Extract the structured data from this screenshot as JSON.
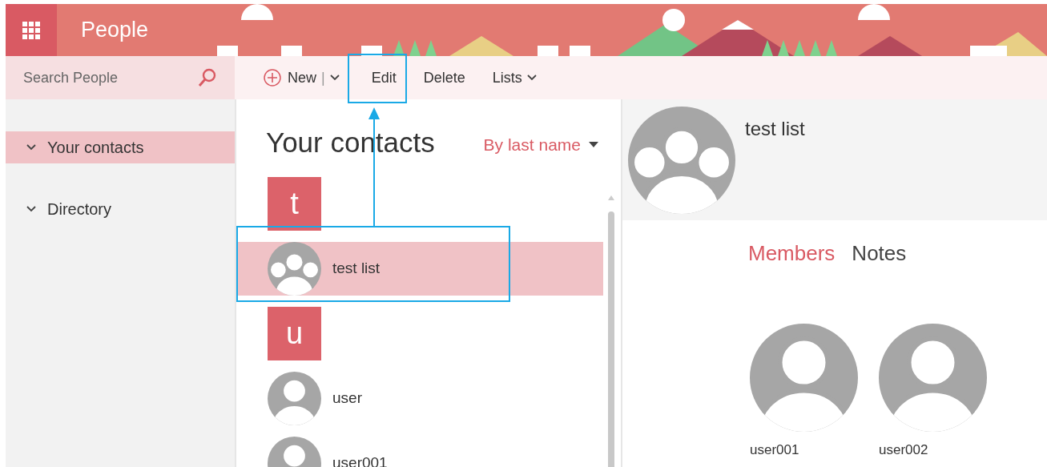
{
  "app": {
    "title": "People"
  },
  "search": {
    "placeholder": "Search People"
  },
  "toolbar": [
    {
      "kind": "new",
      "label": "New",
      "separator": "|"
    },
    {
      "kind": "plain",
      "label": "Edit"
    },
    {
      "kind": "plain",
      "label": "Delete"
    },
    {
      "kind": "menu",
      "label": "Lists"
    }
  ],
  "sidebar": {
    "items": [
      {
        "label": "Your contacts",
        "selected": true
      },
      {
        "label": "Directory",
        "selected": false
      }
    ]
  },
  "contacts": {
    "title": "Your contacts",
    "sort": "By last name",
    "items": [
      {
        "kind": "letter",
        "label": "t"
      },
      {
        "kind": "group",
        "name": "test list",
        "selected": true
      },
      {
        "kind": "letter",
        "label": "u"
      },
      {
        "kind": "person",
        "name": "user",
        "selected": false
      },
      {
        "kind": "person",
        "name": "user001",
        "selected": false
      }
    ]
  },
  "detail": {
    "name": "test list",
    "avatar": {
      "kind": "group"
    },
    "tabs": [
      {
        "label": "Members",
        "selected": true
      },
      {
        "label": "Notes",
        "selected": false
      }
    ],
    "members": [
      {
        "name": "user001"
      },
      {
        "name": "user002"
      }
    ]
  }
}
